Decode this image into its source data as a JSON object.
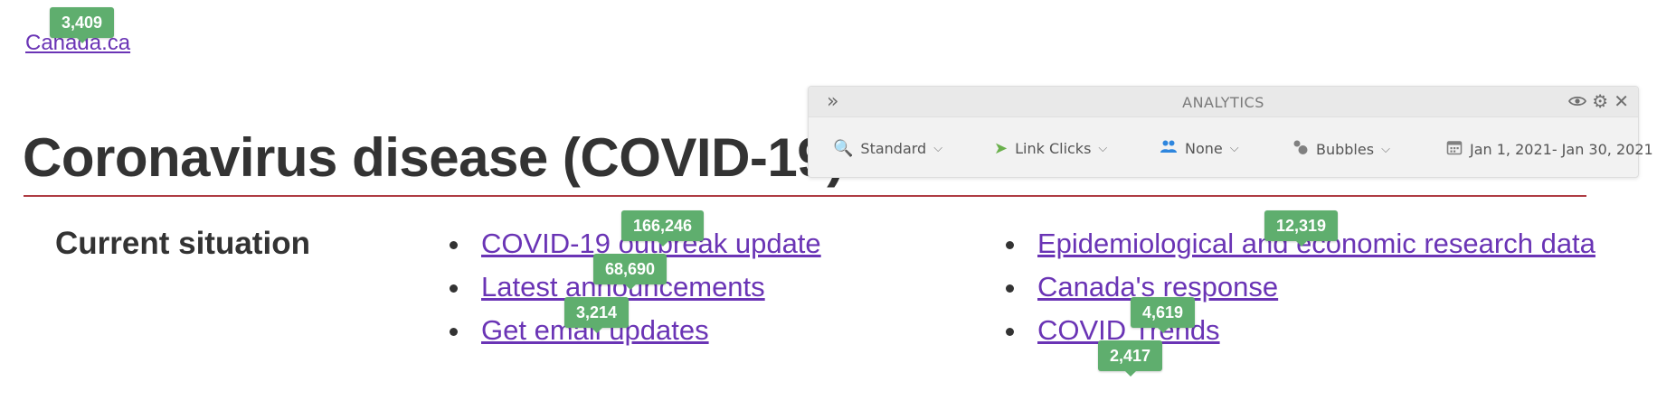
{
  "site": {
    "link_label": "Canada.ca"
  },
  "page": {
    "title": "Coronavirus disease (COVID-19)",
    "section_heading": "Current situation"
  },
  "links_left": [
    {
      "label": "COVID-19 outbreak update",
      "clicks": "166,246"
    },
    {
      "label": "Latest announcements",
      "clicks": "68,690"
    },
    {
      "label": "Get email updates",
      "clicks": "3,214"
    }
  ],
  "links_right": [
    {
      "label": "Epidemiological and economic research data",
      "clicks": "12,319"
    },
    {
      "label": "Canada's response",
      "clicks": "4,619"
    },
    {
      "label": "COVID Trends",
      "clicks": "2,417"
    }
  ],
  "site_link_clicks": "3,409",
  "analytics": {
    "title": "ANALYTICS",
    "controls": {
      "view": "Standard",
      "metric": "Link Clicks",
      "segment": "None",
      "display": "Bubbles",
      "date_range": "Jan 1, 2021- Jan 30, 2021"
    }
  },
  "colors": {
    "link": "#6a34b5",
    "bubble": "#5fae6e",
    "rule": "#af3c43",
    "heading": "#333333"
  },
  "icons": {
    "expand": "double-chevron-right-icon",
    "view": "magnifier-person-icon",
    "metric": "cursor-click-icon",
    "segment": "people-icon",
    "display": "bubbles-icon",
    "date": "calendar-icon",
    "visibility": "eye-icon",
    "settings": "gear-icon",
    "close": "close-icon"
  }
}
